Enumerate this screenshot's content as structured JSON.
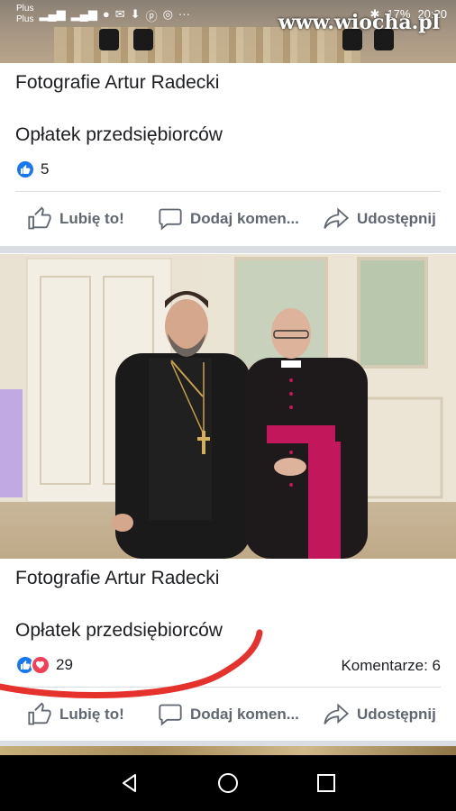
{
  "status_bar": {
    "carrier_1": "Plus",
    "carrier_2": "Plus",
    "battery": "17%",
    "time": "20:20"
  },
  "watermark": "www.wiocha.pl",
  "posts": [
    {
      "source": "Fotografie Artur Radecki",
      "title": "Opłatek przedsiębiorców",
      "reactions_count": "5",
      "actions": {
        "like": "Lubię to!",
        "comment": "Dodaj komen...",
        "share": "Udostępnij"
      }
    },
    {
      "source": "Fotografie Artur Radecki",
      "title": "Opłatek przedsiębiorców",
      "reactions_count": "29",
      "comments": "Komentarze: 6",
      "actions": {
        "like": "Lubię to!",
        "comment": "Dodaj komen...",
        "share": "Udostępnij"
      }
    }
  ],
  "colors": {
    "like_blue": "#1877f2",
    "heart_red": "#f33e58",
    "annotation_red": "#e5322d",
    "action_gray": "#606770"
  },
  "nav": {
    "back": "back-icon",
    "home": "home-icon",
    "recents": "recents-icon"
  }
}
